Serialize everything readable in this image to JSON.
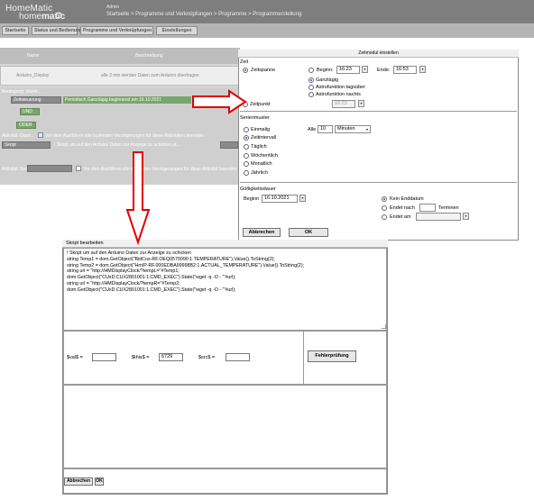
{
  "header": {
    "logo_line1": "HomeMatic",
    "logo_line2_a": "home",
    "logo_line2_b": "matic",
    "user": "Admin",
    "breadcrumb": "Startseite > Programme und Verknüpfungen > Programme > Programmerstellung"
  },
  "nav": [
    "Startseite",
    "Status und Bedienung",
    "Programme und Verknüpfungen",
    "Einstellungen"
  ],
  "background": {
    "col_name": "Name",
    "col_desc": "Beschreibung",
    "program_name": "Arduino_Display",
    "program_desc": "alle 3 min werden Daten zum Arduino übertragen",
    "cond_label": "Bedingung: Wenn...",
    "cond_select": "Zeitsteuerung",
    "cond_text": "Periodisch Ganztägig beginnend am 16.10.2021",
    "cond_and": "UND",
    "or_label": "ODER",
    "activity1_label": "Aktivität: Dann...",
    "activity1_check": "Vor dem Ausführen alle laufenden Verzögerungen für diese Aktivitäten beenden",
    "activity1_select": "Skript",
    "activity1_text": "! Skript um auf den Arduino Daten zur Anzeige zu schicken st...",
    "activity2_label": "Aktivität: Sonst...",
    "activity2_check": "Vor dem Ausführen alle laufenden Verzögerungen für diese Aktivität beenden"
  },
  "zeitmodul": {
    "title": "Zeitmodul einstellen",
    "zeit_label": "Zeit",
    "zeitspanne": "Zeitspanne",
    "beginn_label": "Beginn:",
    "beginn_value": "16:23",
    "ende_label": "Ende:",
    "ende_value": "16:53",
    "ganztaegig": "Ganztägig",
    "astro_tags": "Astrofunktion tagsüber",
    "astro_nachts": "Astrofunktion nachts",
    "zeitpunkt": "Zeitpunkt",
    "zeitpunkt_value": "16:23",
    "serienmuster_label": "Serienmuster",
    "einmalig": "Einmalig",
    "zeitintervall": "Zeitintervall",
    "taeglich": "Täglich",
    "woechentlich": "Wöchentlich",
    "monatlich": "Monatlich",
    "jaehrlich": "Jährlich",
    "alle_label": "Alle",
    "alle_value": "10",
    "alle_unit": "Minuten",
    "gueltig_label": "Gültigkeitsdauer",
    "beginn2_label": "Beginn",
    "beginn2_value": "16.10.2021",
    "kein_enddatum": "Kein Enddatum",
    "endet_nach": "Endet nach",
    "termine": "Terminen",
    "endet_am": "Endet am",
    "cancel": "Abbrechen",
    "ok": "OK"
  },
  "skript": {
    "title": "Skript bearbeiten",
    "code": [
      "! Skript um auf den Arduino Daten zur Anzeige zu schicken",
      "string Temp1 = dom.GetObject(\"BidCos-RF.OEQ0570990:1.TEMPERATURE\").Value().ToString(2);",
      "string Temp2 = dom.GetObject(\"HmIP-RF.000EDBA99998B2:1.ACTUAL_TEMPERATURE\").Value().ToString(2);",
      "string url = \"http://HMDisplayClock/?tempL=\"#Temp1;",
      "dom.GetObject(\"CUxD.CUX2801001:1.CMD_EXEC\").State(\"wget -q -O - '\"#url);",
      "string url = \"http://HMDisplayClock/?tempR=\"#Temp2;",
      "dom.GetObject(\"CUxD.CUX2801001:1.CMD_EXEC\").State(\"wget -q -O - '\"#url);"
    ],
    "var_val_label": "$val$ =",
    "var_val_value": "",
    "var_this_label": "$this$ =",
    "var_this_value": "6729",
    "var_src_label": "$src$ =",
    "var_src_value": "",
    "check_button": "Fehlerprüfung",
    "cancel": "Abbrechen",
    "ok": "OK"
  },
  "colors": {
    "header_bg": "#7e7e7e",
    "nav_bg": "#b4b4b4",
    "arrow_red": "#e00000",
    "radio_blue": "#1f57c7"
  }
}
